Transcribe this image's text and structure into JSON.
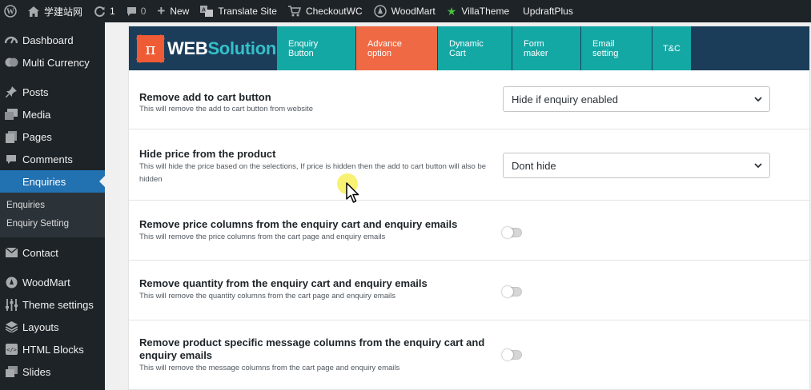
{
  "admin_bar": {
    "site_name": "学建站网",
    "updates_count": "1",
    "comments_count": "0",
    "new_label": "New",
    "items": [
      "Translate Site",
      "CheckoutWC",
      "WoodMart",
      "VillaTheme",
      "UpdraftPlus"
    ]
  },
  "sidebar": {
    "items_top": [
      "Dashboard",
      "Multi Currency"
    ],
    "items_mid": [
      "Posts",
      "Media",
      "Pages",
      "Comments"
    ],
    "active": "Enquiries",
    "submenu": [
      "Enquiries",
      "Enquiry Setting"
    ],
    "items_bottom": [
      "Contact"
    ],
    "items_theme": [
      "WoodMart",
      "Theme settings",
      "Layouts",
      "HTML Blocks",
      "Slides"
    ]
  },
  "plugin": {
    "logo_web": "WEB",
    "logo_solution": "Solution",
    "logo_symbol": "π",
    "tabs": [
      "Enquiry Button",
      "Advance option",
      "Dynamic Cart",
      "Form maker",
      "Email setting",
      "T&C"
    ],
    "active_tab": "Advance option"
  },
  "settings": [
    {
      "title": "Remove add to cart button",
      "desc": "This will remove the add to cart button from website",
      "control": "select",
      "value": "Hide if enquiry enabled"
    },
    {
      "title": "Hide price from the product",
      "desc": "This will hide the price based on the selections, If price is hidden then the add to cart button will also be hidden",
      "control": "select",
      "value": "Dont hide"
    },
    {
      "title": "Remove price columns from the enquiry cart and enquiry emails",
      "desc": "This will remove the price columns from the cart page and enquiry emails",
      "control": "toggle",
      "value": "off"
    },
    {
      "title": "Remove quantity from the enquiry cart and enquiry emails",
      "desc": "This will remove the quantity columns from the cart page and enquiry emails",
      "control": "toggle",
      "value": "off"
    },
    {
      "title": "Remove product specific message columns from the enquiry cart and enquiry emails",
      "desc": "This will remove the message columns from the cart page and enquiry emails",
      "control": "toggle",
      "value": "off"
    }
  ],
  "colors": {
    "admin_bg": "#1d2327",
    "active_menu": "#2271b1",
    "header_bg": "#1b3d5a",
    "tab_teal": "#14a8a5",
    "tab_active": "#ef6a44",
    "logo_orange": "#ef5b34"
  }
}
